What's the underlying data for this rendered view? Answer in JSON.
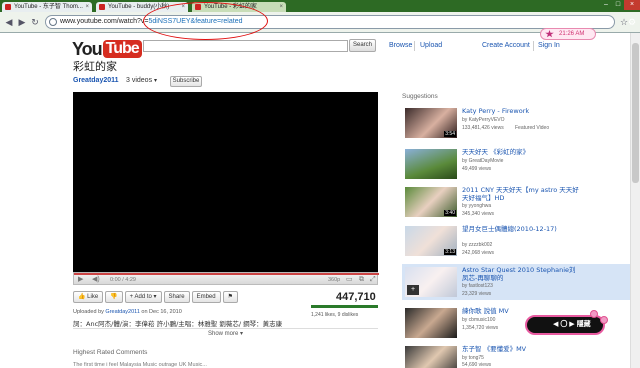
{
  "browser": {
    "tabs": [
      {
        "label": "YouTube - 东子智 Thom...",
        "active": false
      },
      {
        "label": "YouTube - buddy(小秋)",
        "active": false
      },
      {
        "label": "YouTube - 彩虹的家",
        "active": true
      }
    ],
    "url_prefix": "www.youtube.com/watch?v=",
    "url_rest": "5diNSS7UEY&feature=related",
    "float_tag": "21:26 AM"
  },
  "header": {
    "logo_you": "You",
    "logo_tube": "Tube",
    "search_value": "",
    "search_button": "Search",
    "links": [
      "Browse",
      "Upload",
      "Create Account",
      "Sign In"
    ]
  },
  "video": {
    "title": "彩虹的家",
    "channel": "Greatday2011",
    "videos_count": "3 videos",
    "subscribe": "Subscribe",
    "time": "0:00 / 4:29",
    "quality": "360p",
    "views": "447,710",
    "likes_text": "1,241 likes, 9 dislikes",
    "uploaded_prefix": "Uploaded by",
    "uploaded_by": "Greatday2011",
    "uploaded_suffix": "on Dec 16, 2010",
    "description": "詞：Anc阿杰/體/演：李偉菘 許小鵬/主唱：林雅聖 劉薇芯/ 鋼琴：黃志康",
    "show_more": "Show more ▾",
    "comments_heading": "Highest Rated Comments",
    "comment_cut": "The first time i feel Malaysia Music outrage UK Music..."
  },
  "actions": [
    "Like",
    "",
    "Add to ▾",
    "Share",
    "Embed",
    "⚑"
  ],
  "suggestions": {
    "heading": "Suggestions",
    "items": [
      {
        "title": "Katy Perry - Firework",
        "by": "by KatyPerryVEVO",
        "views": "133,481,426 views",
        "extra": "Featured Video",
        "dur": "3:54"
      },
      {
        "title": "天天好天 《彩虹的家》",
        "by": "by GreatDayMovie",
        "views": "49,499 views",
        "extra": "",
        "dur": ""
      },
      {
        "title": "2011 CNY 天天好天【my astro 天天好天好福气】HD",
        "by": "by yyonghwa",
        "views": "345,340 views",
        "extra": "",
        "dur": "3:40"
      },
      {
        "title": "望月女巨士偶體總(2010-12-17)",
        "by": "by zzzzbk002",
        "views": "242,068 views",
        "extra": "",
        "dur": "3:13"
      },
      {
        "title": "Astro Star Quest 2010 Stephanie刘凤芯-再聊聊的",
        "by": "by fastlost123",
        "views": "23,329 views",
        "extra": "",
        "dur": ""
      },
      {
        "title": "練你歌 說值 MV",
        "by": "by cbmusic100",
        "views": "1,354,720 views",
        "extra": "",
        "dur": ""
      },
      {
        "title": "东子智 《要懂爱》MV",
        "by": "by tong75",
        "views": "54,690 views",
        "extra": "",
        "dur": ""
      }
    ]
  },
  "overlay": {
    "bubble_text": "◀ 〇 ▶ 隱藏"
  }
}
